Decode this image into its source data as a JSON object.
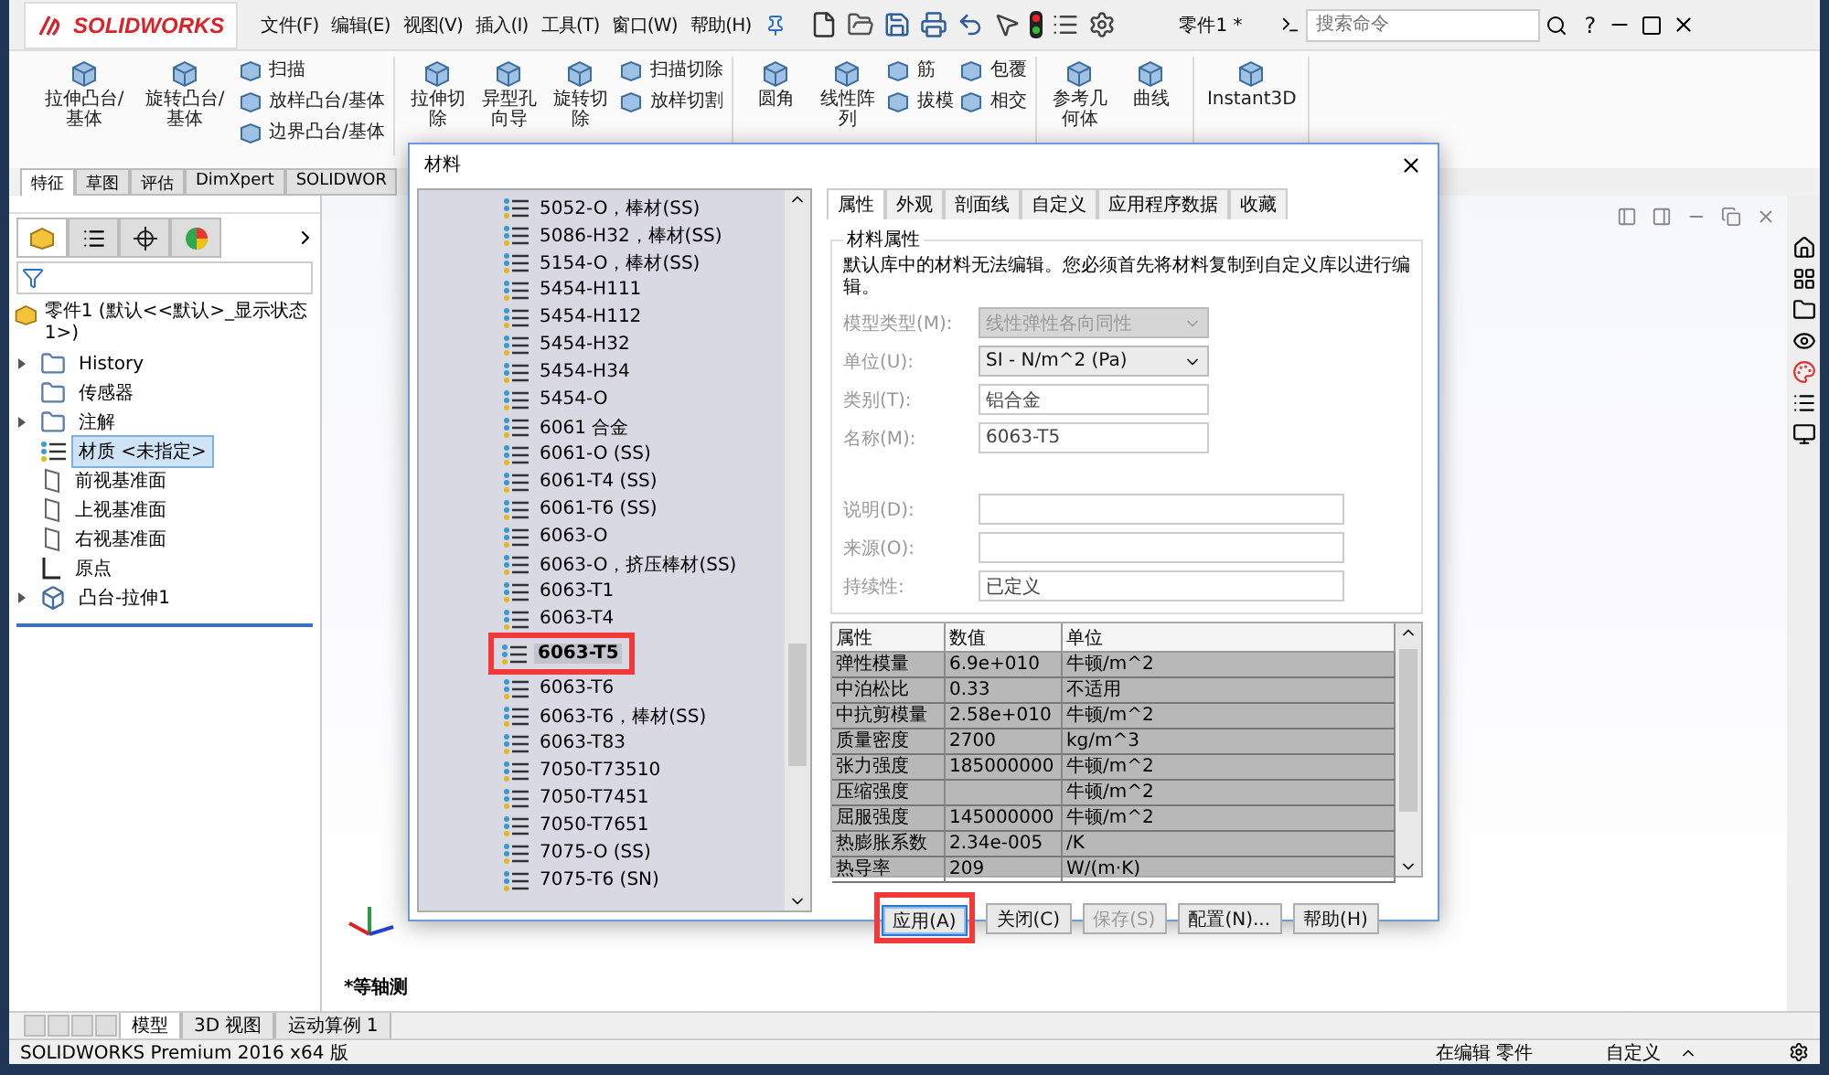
{
  "app": {
    "logo": "SOLIDWORKS",
    "menus": [
      "文件(F)",
      "编辑(E)",
      "视图(V)",
      "插入(I)",
      "工具(T)",
      "窗口(W)",
      "帮助(H)"
    ],
    "title": "零件1 *",
    "search": {
      "placeholder": "搜索命令"
    },
    "help": "?"
  },
  "ribbon": [
    {
      "items": [
        {
          "kind": "large",
          "label": "拉伸凸台/基体"
        },
        {
          "kind": "large",
          "label": "旋转凸台/基体"
        },
        {
          "kind": "stack",
          "items": [
            "扫描",
            "放样凸台/基体",
            "边界凸台/基体"
          ]
        }
      ]
    },
    {
      "items": [
        {
          "kind": "large",
          "label": "拉伸切除"
        },
        {
          "kind": "large",
          "label": "异型孔向导"
        },
        {
          "kind": "large",
          "label": "旋转切除"
        },
        {
          "kind": "stack",
          "items": [
            "扫描切除",
            "放样切割"
          ]
        }
      ]
    },
    {
      "items": [
        {
          "kind": "large",
          "label": "圆角"
        },
        {
          "kind": "large",
          "label": "线性阵列"
        },
        {
          "kind": "stack",
          "items": [
            "筋",
            "拔模"
          ]
        },
        {
          "kind": "stack",
          "items": [
            "包覆",
            "相交"
          ]
        }
      ]
    },
    {
      "items": [
        {
          "kind": "large",
          "label": "参考几何体"
        },
        {
          "kind": "large",
          "label": "曲线"
        }
      ]
    },
    {
      "items": [
        {
          "kind": "large",
          "label": "Instant3D"
        }
      ]
    }
  ],
  "command_tabs": [
    {
      "label": "特征",
      "selected": true
    },
    {
      "label": "草图",
      "selected": false
    },
    {
      "label": "评估",
      "selected": false
    },
    {
      "label": "DimXpert",
      "selected": false
    },
    {
      "label": "SOLIDWOR",
      "selected": false
    }
  ],
  "feature_tree": {
    "tabs": [
      {
        "kind": "part",
        "selected": true
      },
      {
        "kind": "property",
        "selected": false
      },
      {
        "kind": "config",
        "selected": false
      },
      {
        "kind": "display",
        "selected": false
      }
    ],
    "root": "零件1 (默认<<默认>_显示状态 1>)",
    "items": [
      {
        "label": "History",
        "kind": "folder",
        "collapsed": true,
        "selected": false
      },
      {
        "label": "传感器",
        "kind": "folder",
        "collapsed": false,
        "selected": false
      },
      {
        "label": "注解",
        "kind": "folder",
        "collapsed": true,
        "selected": false
      },
      {
        "label": "材质 <未指定>",
        "kind": "material",
        "collapsed": false,
        "selected": true
      },
      {
        "label": "前视基准面",
        "kind": "plane",
        "collapsed": false,
        "selected": false
      },
      {
        "label": "上视基准面",
        "kind": "plane",
        "collapsed": false,
        "selected": false
      },
      {
        "label": "右视基准面",
        "kind": "plane",
        "collapsed": false,
        "selected": false
      },
      {
        "label": "原点",
        "kind": "origin",
        "collapsed": false,
        "selected": false
      },
      {
        "label": "凸台-拉伸1",
        "kind": "feature",
        "collapsed": true,
        "selected": false
      }
    ]
  },
  "viewport": {
    "view_name": "*等轴测"
  },
  "dialog": {
    "title": "材料",
    "materials": [
      {
        "name": "5052-O，棒材(SS)",
        "selected": false,
        "highlighted": false
      },
      {
        "name": "5086-H32，棒材(SS)",
        "selected": false,
        "highlighted": false
      },
      {
        "name": "5154-O，棒材(SS)",
        "selected": false,
        "highlighted": false
      },
      {
        "name": "5454-H111",
        "selected": false,
        "highlighted": false
      },
      {
        "name": "5454-H112",
        "selected": false,
        "highlighted": false
      },
      {
        "name": "5454-H32",
        "selected": false,
        "highlighted": false
      },
      {
        "name": "5454-H34",
        "selected": false,
        "highlighted": false
      },
      {
        "name": "5454-O",
        "selected": false,
        "highlighted": false
      },
      {
        "name": "6061 合金",
        "selected": false,
        "highlighted": false
      },
      {
        "name": "6061-O (SS)",
        "selected": false,
        "highlighted": false
      },
      {
        "name": "6061-T4 (SS)",
        "selected": false,
        "highlighted": false
      },
      {
        "name": "6061-T6 (SS)",
        "selected": false,
        "highlighted": false
      },
      {
        "name": "6063-O",
        "selected": false,
        "highlighted": false
      },
      {
        "name": "6063-O，挤压棒材(SS)",
        "selected": false,
        "highlighted": false
      },
      {
        "name": "6063-T1",
        "selected": false,
        "highlighted": false
      },
      {
        "name": "6063-T4",
        "selected": false,
        "highlighted": false
      },
      {
        "name": "6063-T5",
        "selected": true,
        "highlighted": true
      },
      {
        "name": "6063-T6",
        "selected": false,
        "highlighted": false
      },
      {
        "name": "6063-T6，棒材(SS)",
        "selected": false,
        "highlighted": false
      },
      {
        "name": "6063-T83",
        "selected": false,
        "highlighted": false
      },
      {
        "name": "7050-T73510",
        "selected": false,
        "highlighted": false
      },
      {
        "name": "7050-T7451",
        "selected": false,
        "highlighted": false
      },
      {
        "name": "7050-T7651",
        "selected": false,
        "highlighted": false
      },
      {
        "name": "7075-O (SS)",
        "selected": false,
        "highlighted": false
      },
      {
        "name": "7075-T6 (SN)",
        "selected": false,
        "highlighted": false
      }
    ],
    "tabs": [
      {
        "label": "属性",
        "selected": true
      },
      {
        "label": "外观",
        "selected": false
      },
      {
        "label": "剖面线",
        "selected": false
      },
      {
        "label": "自定义",
        "selected": false
      },
      {
        "label": "应用程序数据",
        "selected": false
      },
      {
        "label": "收藏",
        "selected": false
      }
    ],
    "group_title": "材料属性",
    "note": "默认库中的材料无法编辑。您必须首先将材料复制到自定义库以进行编辑。",
    "fields": [
      {
        "label": "模型类型(M):",
        "kind": "select",
        "value": "线性弹性各向同性",
        "disabled": true
      },
      {
        "label": "单位(U):",
        "kind": "select",
        "value": "SI - N/m^2 (Pa)",
        "disabled": false
      },
      {
        "label": "类别(T):",
        "kind": "text",
        "value": "铝合金"
      },
      {
        "label": "名称(M):",
        "kind": "text",
        "value": "6063-T5"
      },
      {
        "kind": "spacer"
      },
      {
        "label": "说明(D):",
        "kind": "wide"
      },
      {
        "label": "来源(O):",
        "kind": "wide"
      },
      {
        "label": "持续性:",
        "kind": "wide",
        "value": "已定义"
      }
    ],
    "table": {
      "columns": [
        "属性",
        "数值",
        "单位"
      ],
      "rows": [
        [
          "弹性模量",
          "6.9e+010",
          "牛顿/m^2"
        ],
        [
          "中泊松比",
          "0.33",
          "不适用"
        ],
        [
          "中抗剪模量",
          "2.58e+010",
          "牛顿/m^2"
        ],
        [
          "质量密度",
          "2700",
          "kg/m^3"
        ],
        [
          "张力强度",
          "185000000",
          "牛顿/m^2"
        ],
        [
          "压缩强度",
          "",
          "牛顿/m^2"
        ],
        [
          "屈服强度",
          "145000000",
          "牛顿/m^2"
        ],
        [
          "热膨胀系数",
          "2.34e-005",
          "/K"
        ],
        [
          "热导率",
          "209",
          "W/(m·K)"
        ]
      ]
    },
    "buttons": [
      {
        "label": "应用(A)",
        "default": true,
        "disabled": false,
        "highlighted": true
      },
      {
        "label": "关闭(C)",
        "default": false,
        "disabled": false,
        "highlighted": false
      },
      {
        "label": "保存(S)",
        "default": false,
        "disabled": true,
        "highlighted": false
      },
      {
        "label": "配置(N)...",
        "default": false,
        "disabled": false,
        "highlighted": false
      },
      {
        "label": "帮助(H)",
        "default": false,
        "disabled": false,
        "highlighted": false
      }
    ]
  },
  "bottom_tabs": [
    {
      "label": "模型",
      "selected": true
    },
    {
      "label": "3D 视图",
      "selected": false
    },
    {
      "label": "运动算例 1",
      "selected": false
    }
  ],
  "status_bar": {
    "product": "SOLIDWORKS Premium 2016 x64 版",
    "mode": "在编辑 零件",
    "units": "自定义"
  }
}
